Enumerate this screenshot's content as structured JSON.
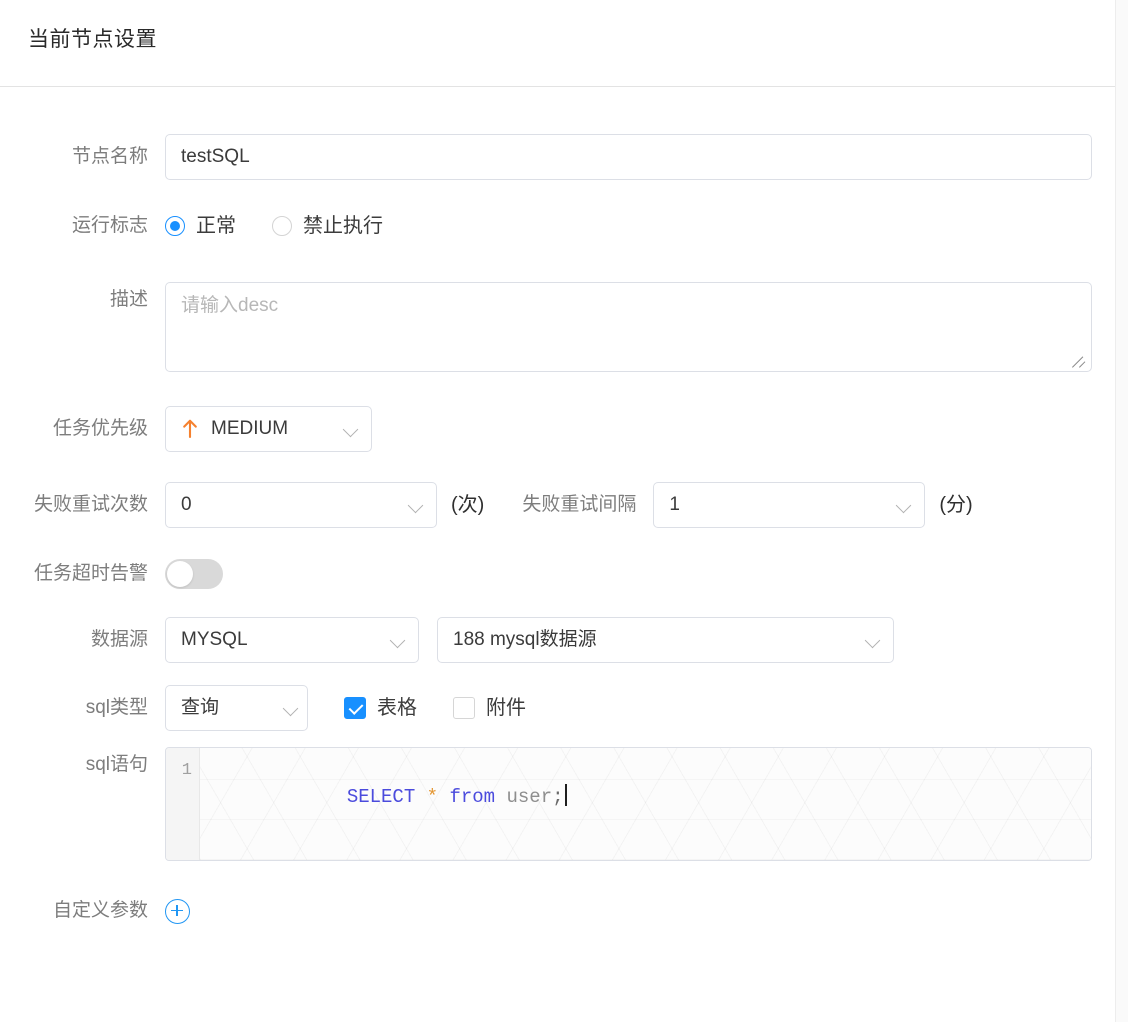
{
  "header": {
    "title": "当前节点设置"
  },
  "form": {
    "node_name": {
      "label": "节点名称",
      "value": "testSQL"
    },
    "run_flag": {
      "label": "运行标志",
      "options": [
        {
          "label": "正常",
          "selected": true
        },
        {
          "label": "禁止执行",
          "selected": false
        }
      ]
    },
    "description": {
      "label": "描述",
      "value": "",
      "placeholder": "请输入desc"
    },
    "priority": {
      "label": "任务优先级",
      "value": "MEDIUM",
      "icon": "arrow-up-icon",
      "icon_color": "#f5812f"
    },
    "retry_times": {
      "label": "失败重试次数",
      "value": "0",
      "unit": "(次)"
    },
    "retry_interval": {
      "label": "失败重试间隔",
      "value": "1",
      "unit": "(分)"
    },
    "timeout_alarm": {
      "label": "任务超时告警",
      "on": false
    },
    "datasource": {
      "label": "数据源",
      "type_value": "MYSQL",
      "name_value": "188 mysql数据源"
    },
    "sql_type": {
      "label": "sql类型",
      "value": "查询",
      "checkboxes": [
        {
          "label": "表格",
          "checked": true
        },
        {
          "label": "附件",
          "checked": false
        }
      ]
    },
    "sql_statement": {
      "label": "sql语句",
      "line_number": "1",
      "tokens": [
        {
          "text": "SELECT",
          "type": "kw"
        },
        {
          "text": " ",
          "type": "pn"
        },
        {
          "text": "*",
          "type": "op"
        },
        {
          "text": " ",
          "type": "pn"
        },
        {
          "text": "from",
          "type": "kw"
        },
        {
          "text": " ",
          "type": "pn"
        },
        {
          "text": "user",
          "type": "id"
        },
        {
          "text": ";",
          "type": "pn"
        }
      ],
      "plain": "SELECT * from user;"
    },
    "custom_params": {
      "label": "自定义参数",
      "add_icon": "plus-circle-icon"
    }
  },
  "colors": {
    "accent_blue": "#1890ff",
    "priority_orange": "#f5812f",
    "add_blue": "#2196f3",
    "keyword_blue": "#4b4bdd",
    "operator_orange": "#e3942e"
  }
}
